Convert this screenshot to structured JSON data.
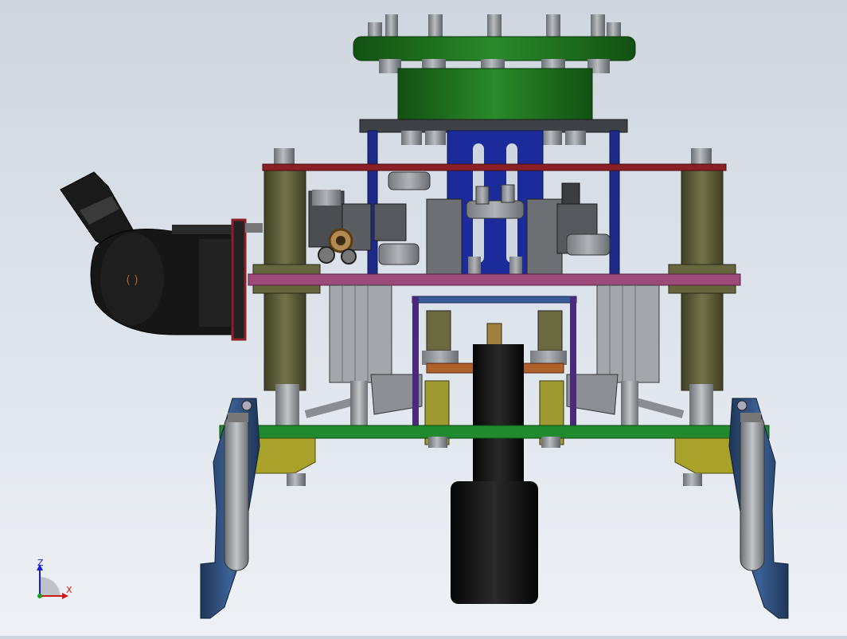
{
  "triad": {
    "z_label": "Z",
    "x_label": "X",
    "z_color": "#1a1adf",
    "x_color": "#d01818",
    "y_color": "#18a018"
  },
  "colors": {
    "flange_green": "#1f7a1f",
    "flange_green_dark": "#115a11",
    "bolt_gray": "#8d9296",
    "frame_blue": "#1e2a8a",
    "plate_red": "#8a1f25",
    "plate_pink": "#9b4a7a",
    "plate_green": "#1f8a2e",
    "column_olive": "#5a5a35",
    "cylinder_gray": "#9a9ea3",
    "motor_black": "#141414",
    "jaw_blue": "#2d4c7a",
    "bracket_yellow": "#a8a22a",
    "orange_bar": "#b0602a"
  }
}
